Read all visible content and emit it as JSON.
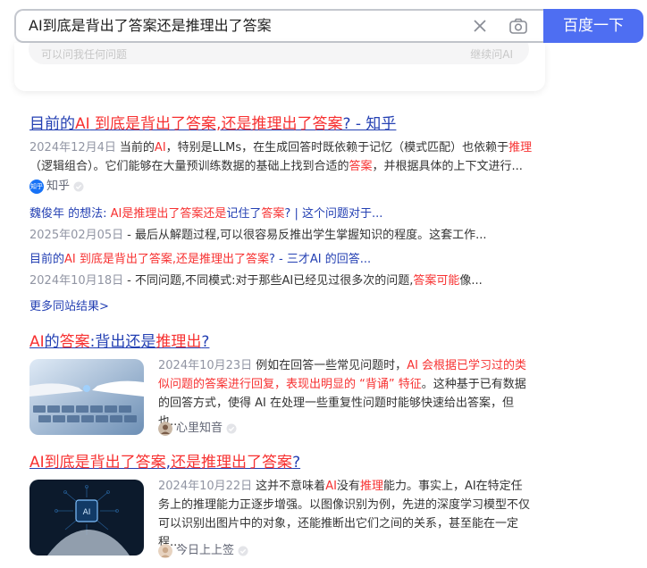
{
  "search": {
    "query": "AI到底是背出了答案还是推理出了答案",
    "button_label": "百度一下"
  },
  "ask_card": {
    "placeholder": "可以问我任何问题",
    "continue_label": "继续问AI"
  },
  "result1": {
    "title_pre": "目前的",
    "title_hl1": "AI",
    "title_mid": " 到底是背出了答案,还是推理出了答案",
    "title_post": "? - 知乎",
    "date": "2024年12月4日",
    "abs_a": "当前的",
    "abs_hl1": "AI",
    "abs_b": "，特别是LLMs，在生成回答时既依赖于记忆（模式匹配）也依赖于",
    "abs_hl2": "推理",
    "abs_c": "（逻辑组合）。它们能够在大量预训练数据的基础上找到合适的",
    "abs_hl3": "答案",
    "abs_d": "，并根据具体的上下文进行...",
    "source": "知乎",
    "source_logo": "知乎",
    "sub1_title_a": "魏俊年 的想法: ",
    "sub1_title_hl": "AI是推理出了答案还是",
    "sub1_title_b": "记住了",
    "sub1_title_hl2": "答案",
    "sub1_title_c": "? | 这个问题对于...",
    "sub1_date": "2025年02月05日",
    "sub1_abs": "- 最后从解题过程,可以很容易反推出学生掌握知识的程度。这套工作...",
    "sub2_title_a": "目前的",
    "sub2_title_hl": "AI 到底是背出了答案,还是推理出了答案",
    "sub2_title_b": "? - 三才AI 的回答...",
    "sub2_date": "2024年10月18日",
    "sub2_abs_a": "- 不同问题,不同模式:对于那些AI已经见过很多次的问题,",
    "sub2_abs_hl": "答案可能",
    "sub2_abs_b": "像...",
    "more": "更多同站结果>"
  },
  "result2": {
    "title_hl1": "AI",
    "title_a": "的",
    "title_hl2": "答案",
    "title_b": ":背出还是",
    "title_hl3": "推理出",
    "title_c": "?",
    "date": "2024年10月23日",
    "abs_a": "例如在回答一些常见问题时，",
    "abs_hl": "AI 会根据已学习过的类似问题的答案进行回复，表现出明显的 “背诵” 特征",
    "abs_b": "。这种基于已有数据的回答方式，使得 AI 在处理一些重复性问题时能够快速给出答案，但也...",
    "source": "心里知音"
  },
  "result3": {
    "title_hl1": "AI到底是背出了答案",
    "title_a": ",",
    "title_hl2": "还是推理出了答案",
    "title_b": "?",
    "date": "2024年10月22日",
    "abs_a": "这并不意味着",
    "abs_hl1": "AI",
    "abs_b": "没有",
    "abs_hl2": "推理",
    "abs_c": "能力。事实上，AI在特定任务上的推理能力正逐步增强。以图像识别为例，先进的深度学习模型不仅可以识别出图片中的对象，还能推断出它们之间的关系，甚至能在一定程...",
    "source": "今日上上签",
    "thumb_text": "AI"
  },
  "colors": {
    "accent": "#4e6ef2",
    "link": "#2440b3",
    "highlight": "#f73131",
    "meta": "#9195a3"
  }
}
